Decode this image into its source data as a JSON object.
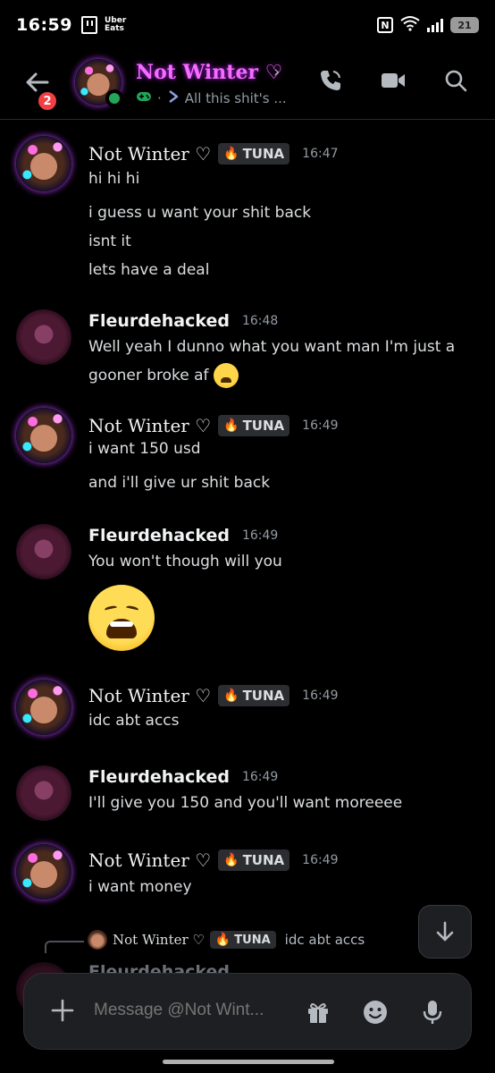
{
  "status_bar": {
    "time": "16:59",
    "uber_eats": "Uber\nEats",
    "nfc": "N",
    "wifi": "6E",
    "battery": "21"
  },
  "header": {
    "unread_count": "2",
    "name": "Not Winter ♡",
    "chevron": "›",
    "activity": "All this shit's ...",
    "name_color": "#f56cff"
  },
  "messages": [
    {
      "author": "Not Winter ♡",
      "tag": "TUNA",
      "time": "16:47",
      "lines": [
        "hi hi hi",
        "i guess u want your shit back",
        "isnt it",
        "lets have a deal"
      ]
    },
    {
      "author": "Fleurdehacked",
      "time": "16:48",
      "lines": [
        "Well yeah I dunno what you want man I'm just a",
        "gooner broke af"
      ]
    },
    {
      "author": "Not Winter ♡",
      "tag": "TUNA",
      "time": "16:49",
      "lines": [
        "i want 150 usd",
        "and i'll give ur shit back"
      ]
    },
    {
      "author": "Fleurdehacked",
      "time": "16:49",
      "lines": [
        "You won't though will you"
      ]
    },
    {
      "author": "Not Winter ♡",
      "tag": "TUNA",
      "time": "16:49",
      "lines": [
        "idc abt accs"
      ]
    },
    {
      "author": "Fleurdehacked",
      "time": "16:49",
      "lines": [
        "I'll give you 150 and you'll want moreeee"
      ]
    },
    {
      "author": "Not Winter ♡",
      "tag": "TUNA",
      "time": "16:49",
      "lines": [
        "i want money"
      ]
    }
  ],
  "reply": {
    "author": "Not Winter ♡",
    "tag": "TUNA",
    "text": "idc abt accs"
  },
  "partial_author": "Fleurdehacked",
  "composer": {
    "placeholder": "Message @Not Wint..."
  },
  "colors": {
    "background": "#000000",
    "panel": "#1e1f22",
    "online": "#23a55a",
    "badge": "#f23f43"
  }
}
